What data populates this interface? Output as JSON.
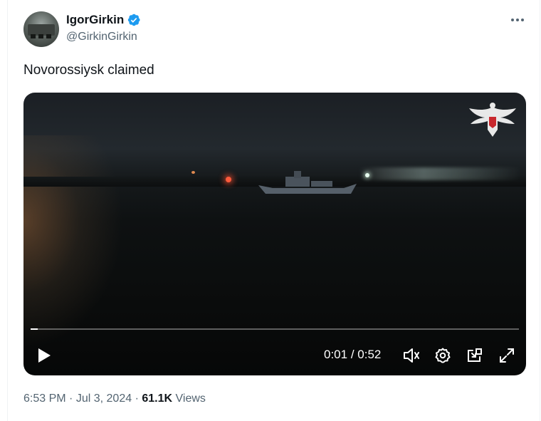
{
  "author": {
    "display_name": "IgorGirkin",
    "handle": "@GirkinGirkin",
    "verified": true,
    "verified_color": "#1d9bf0"
  },
  "tweet": {
    "text": "Novorossiysk claimed"
  },
  "video": {
    "current_time": "0:01",
    "separator": "/",
    "duration": "0:52",
    "progress": 0.015,
    "icons": [
      "play-icon",
      "volume-icon",
      "settings-icon",
      "pip-icon",
      "fullscreen-icon"
    ]
  },
  "meta": {
    "time": "6:53 PM",
    "dot1": "·",
    "date": "Jul 3, 2024",
    "dot2": "·",
    "views_count": "61.1K",
    "views_label": "Views"
  },
  "colors": {
    "text_primary": "#0f1419",
    "text_secondary": "#536471",
    "accent": "#1d9bf0"
  }
}
